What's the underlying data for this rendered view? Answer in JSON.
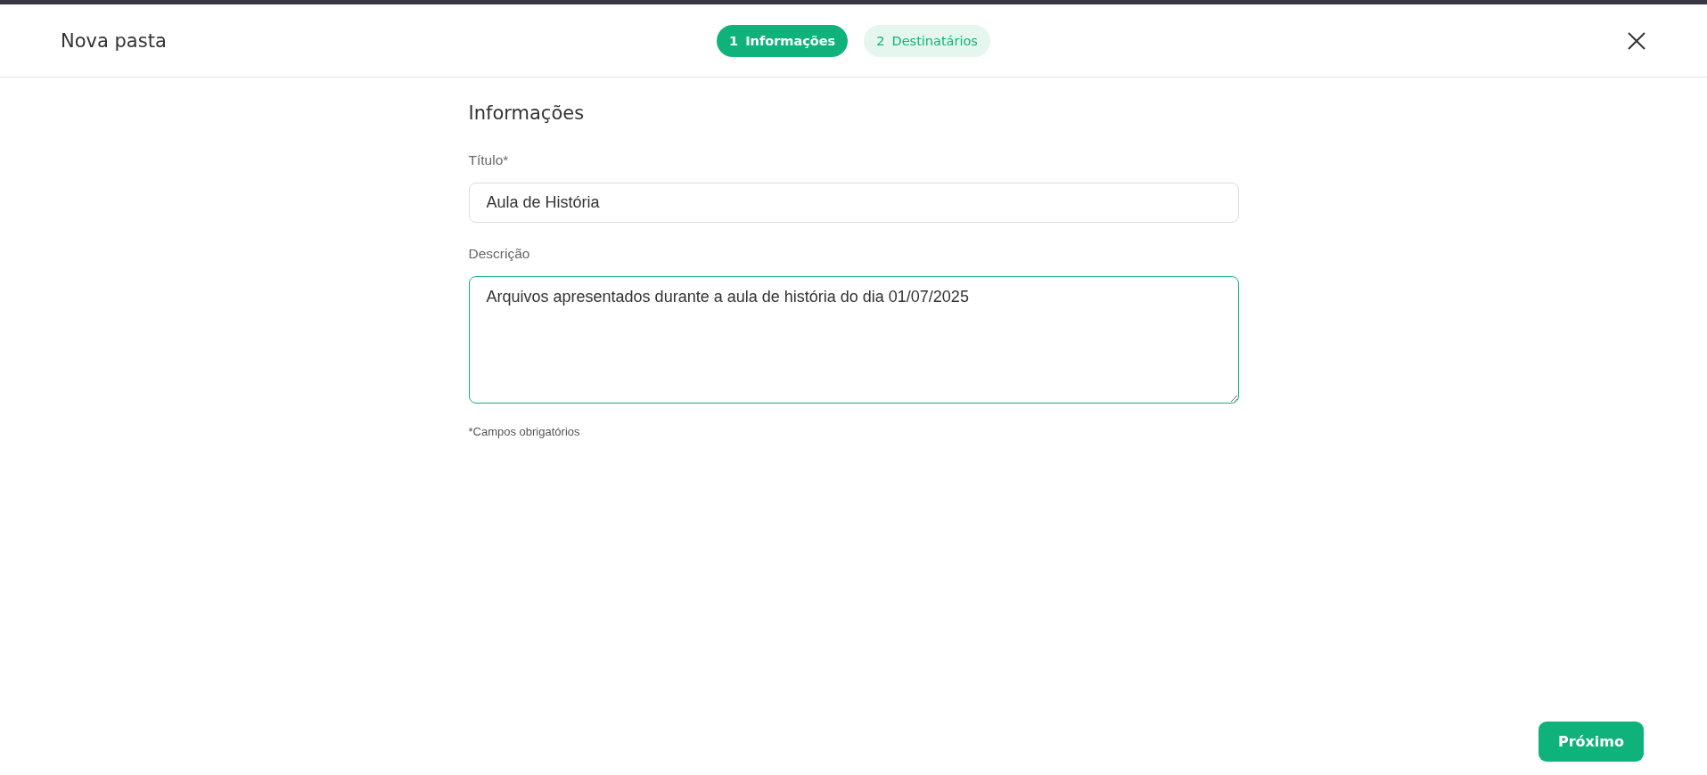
{
  "header": {
    "title": "Nova pasta"
  },
  "steps": [
    {
      "number": "1",
      "label": "Informações",
      "selected": true
    },
    {
      "number": "2",
      "label": "Destinatários",
      "selected": false
    }
  ],
  "section": {
    "title": "Informações"
  },
  "fields": [
    {
      "kind": "input",
      "label": "Título*",
      "value": "Aula de História",
      "focused": false
    },
    {
      "kind": "textarea",
      "label": "Descrição",
      "value": "Arquivos apresentados durante a aula de história do dia 01/07/2025",
      "focused": true
    }
  ],
  "note": "*Campos obrigatórios",
  "next_button": "Próximo"
}
